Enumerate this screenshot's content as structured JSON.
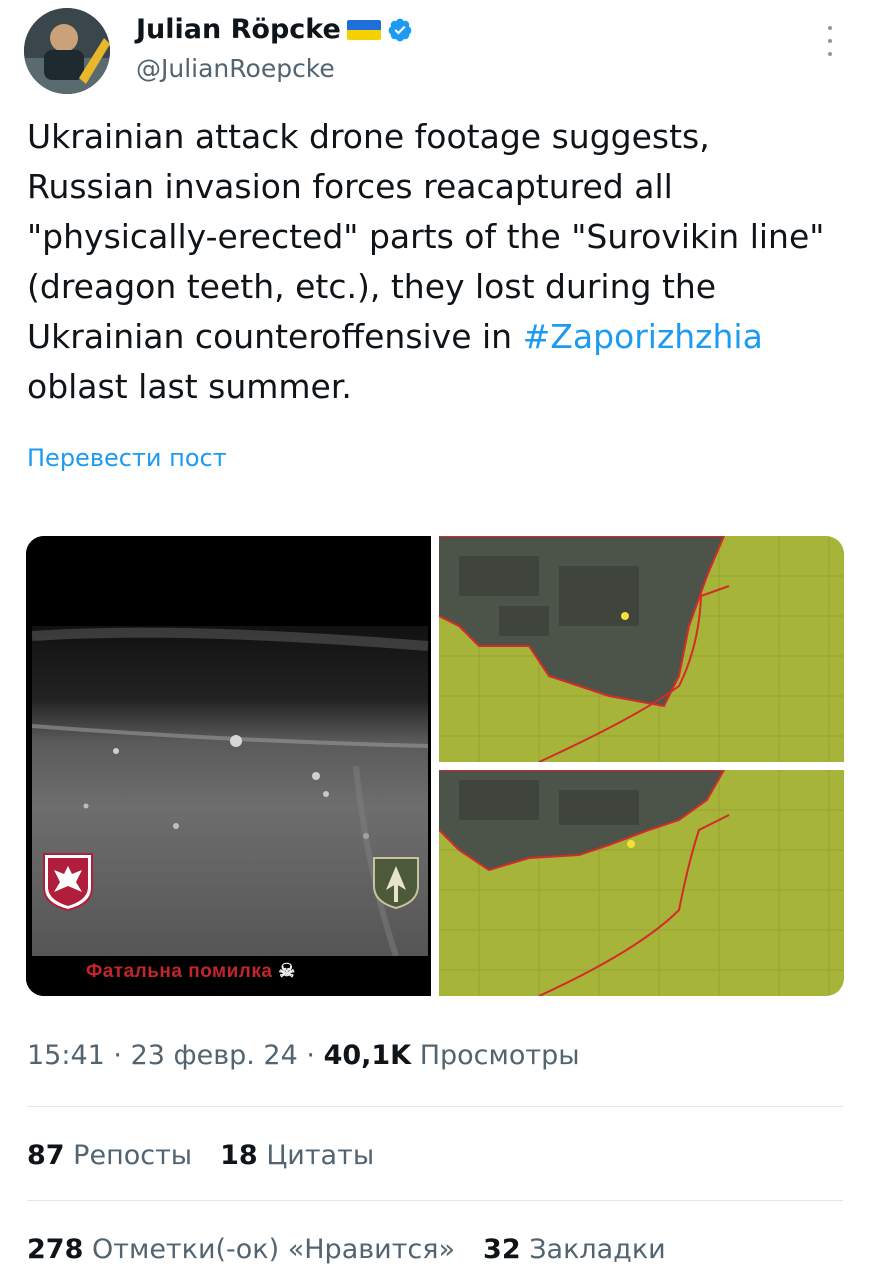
{
  "author": {
    "name": "Julian Röpcke",
    "handle": "@JulianRoepcke",
    "flag_icon": "ukraine-flag",
    "verified_icon": "verified-badge-icon",
    "colors": {
      "verified": "#1d9bf0",
      "flag_blue": "#1e6fd9",
      "flag_yellow": "#f6d100"
    }
  },
  "tweet": {
    "text_before_hashtag": "Ukrainian attack drone footage suggests, Russian invasion forces reacaptured all \"physically-erected\" parts of the \"Surovikin line\" (dreagon teeth, etc.), they lost during the Ukrainian counteroffensive in ",
    "hashtag": "#Zaporizhzhia",
    "text_after_hashtag": " oblast last summer.",
    "translate_label": "Перевести пост"
  },
  "media": {
    "thermal_caption": "Фатальна помилка",
    "skull_icon": "skull-icon",
    "emblem_left": "eagle-emblem-icon",
    "emblem_right": "shield-emblem-icon"
  },
  "meta": {
    "time": "15:41",
    "date": "23 февр. 24",
    "views_count": "40,1K",
    "views_label": "Просмотры"
  },
  "stats": {
    "reposts_count": "87",
    "reposts_label": "Репосты",
    "quotes_count": "18",
    "quotes_label": "Цитаты",
    "likes_count": "278",
    "likes_label": "Отметки(-ок) «Нравится»",
    "bookmarks_count": "32",
    "bookmarks_label": "Закладки"
  }
}
